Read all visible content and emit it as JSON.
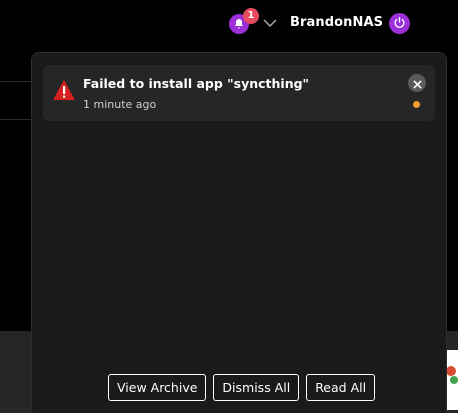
{
  "header": {
    "notification_count": "1",
    "user_name": "BrandonNAS"
  },
  "notifications": [
    {
      "title": "Failed to install app \"syncthing\"",
      "time": "1 minute ago",
      "severity_icon": "warning-triangle-icon",
      "status": "unread"
    }
  ],
  "actions": {
    "view_archive": "View Archive",
    "dismiss_all": "Dismiss All",
    "read_all": "Read All"
  },
  "colors": {
    "accent": "#9b30d9",
    "badge": "#e84a5f",
    "warning": "#d62020",
    "unread_dot": "#f0a030",
    "panel_bg": "#1a1a1a",
    "card_bg": "#262626"
  }
}
